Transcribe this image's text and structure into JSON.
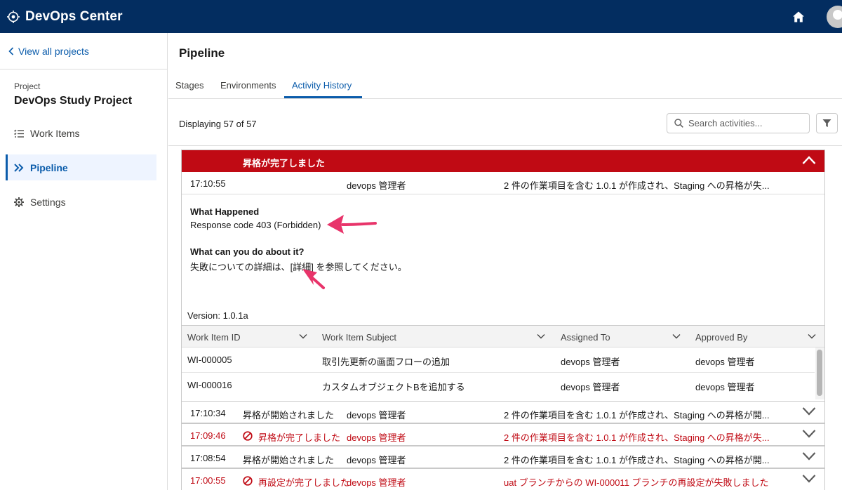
{
  "header": {
    "app_title": "DevOps Center"
  },
  "sidebar": {
    "back_link": "View all projects",
    "project_label": "Project",
    "project_name": "DevOps Study Project",
    "items": [
      {
        "label": "Work Items",
        "icon": "list-icon"
      },
      {
        "label": "Pipeline",
        "icon": "pipeline-icon",
        "active": true
      },
      {
        "label": "Settings",
        "icon": "gear-icon"
      }
    ]
  },
  "main": {
    "title": "Pipeline",
    "tabs": [
      {
        "label": "Stages"
      },
      {
        "label": "Environments"
      },
      {
        "label": "Activity History",
        "active": true
      }
    ],
    "count_text": "Displaying 57 of 57",
    "search_placeholder": "Search activities..."
  },
  "expanded": {
    "title": "昇格が完了しました",
    "time": "17:10:55",
    "user": "devops 管理者",
    "description": "2 件の作業項目を含む 1.0.1 が作成され、Staging への昇格が失...",
    "what_happened_label": "What Happened",
    "what_happened_text": "Response code 403 (Forbidden)",
    "what_can_label": "What can you do about it?",
    "what_can_text_before": "失敗についての詳細は、",
    "what_can_link": "[詳細]",
    "what_can_text_after": " を参照してください。",
    "version": "Version: 1.0.1a",
    "table": {
      "columns": [
        "Work Item ID",
        "Work Item Subject",
        "Assigned To",
        "Approved By"
      ],
      "rows": [
        [
          "WI-000005",
          "取引先更新の画面フローの追加",
          "devops 管理者",
          "devops 管理者"
        ],
        [
          "WI-000016",
          "カスタムオブジェクトBを追加する",
          "devops 管理者",
          "devops 管理者"
        ]
      ]
    }
  },
  "activities": [
    {
      "time": "17:10:34",
      "status": "昇格が開始されました",
      "user": "devops 管理者",
      "description": "2 件の作業項目を含む 1.0.1 が作成され、Staging への昇格が開...",
      "failed": false
    },
    {
      "time": "17:09:46",
      "status": "昇格が完了しました",
      "user": "devops 管理者",
      "description": "2 件の作業項目を含む 1.0.1 が作成され、Staging への昇格が失...",
      "failed": true
    },
    {
      "time": "17:08:54",
      "status": "昇格が開始されました",
      "user": "devops 管理者",
      "description": "2 件の作業項目を含む 1.0.1 が作成され、Staging への昇格が開...",
      "failed": false
    },
    {
      "time": "17:00:55",
      "status": "再設定が完了しました",
      "user": "devops 管理者",
      "description": "uat ブランチからの WI-000011 ブランチの再設定が失敗しました",
      "failed": true
    }
  ],
  "colors": {
    "header_bg": "#032d60",
    "accent": "#0b5cab",
    "error": "#c00a14",
    "annotation_arrow": "#e8346a"
  }
}
